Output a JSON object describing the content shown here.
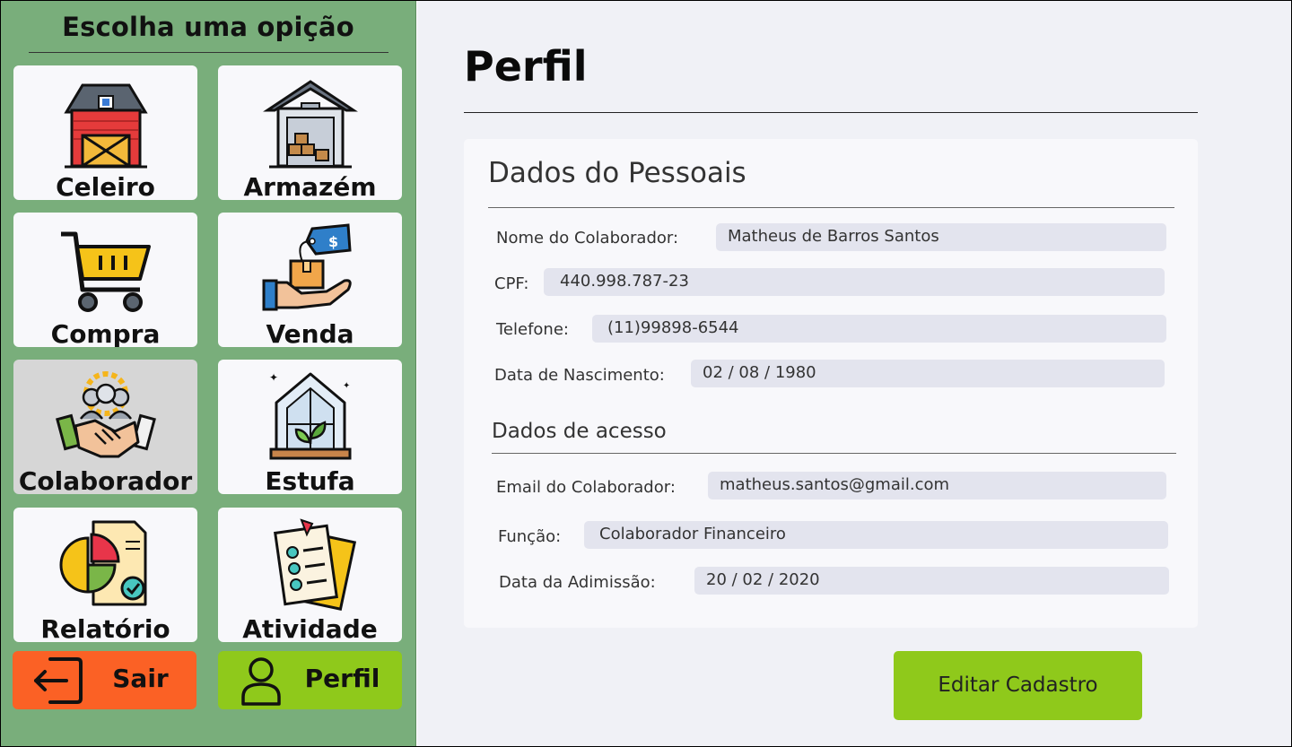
{
  "sidebar": {
    "title": "Escolha uma opição",
    "tiles": [
      {
        "label": "Celeiro",
        "icon": "barn-icon"
      },
      {
        "label": "Armazém",
        "icon": "warehouse-icon"
      },
      {
        "label": "Compra",
        "icon": "shopping-cart-icon"
      },
      {
        "label": "Venda",
        "icon": "sale-hand-box-icon"
      },
      {
        "label": "Colaborador",
        "icon": "collaborator-handshake-icon"
      },
      {
        "label": "Estufa",
        "icon": "greenhouse-icon"
      },
      {
        "label": "Relatório",
        "icon": "report-chart-icon"
      },
      {
        "label": "Atividade",
        "icon": "activity-checklist-icon"
      }
    ],
    "active_tile": "Colaborador",
    "logout_label": "Sair",
    "profile_label": "Perfil"
  },
  "main": {
    "title": "Perfil",
    "personal_title": "Dados do Pessoais",
    "access_title": "Dados de acesso",
    "fields": {
      "nome_label": "Nome do Colaborador:",
      "nome_value": "Matheus de Barros Santos",
      "cpf_label": "CPF:",
      "cpf_value": "440.998.787-23",
      "telefone_label": "Telefone:",
      "telefone_value": "(11)99898-6544",
      "nascimento_label": "Data de Nascimento:",
      "nascimento_value": "02 / 08 / 1980",
      "email_label": "Email do Colaborador:",
      "email_value": "matheus.santos@gmail.com",
      "funcao_label": "Função:",
      "funcao_value": "Colaborador Financeiro",
      "admissao_label": "Data da Adimissão:",
      "admissao_value": "20 / 02 / 2020"
    },
    "edit_label": "Editar Cadastro"
  },
  "colors": {
    "sidebar_bg": "#79ae7b",
    "logout_bg": "#fb6125",
    "profile_bg": "#8fc91b",
    "edit_bg": "#8fc91b"
  }
}
